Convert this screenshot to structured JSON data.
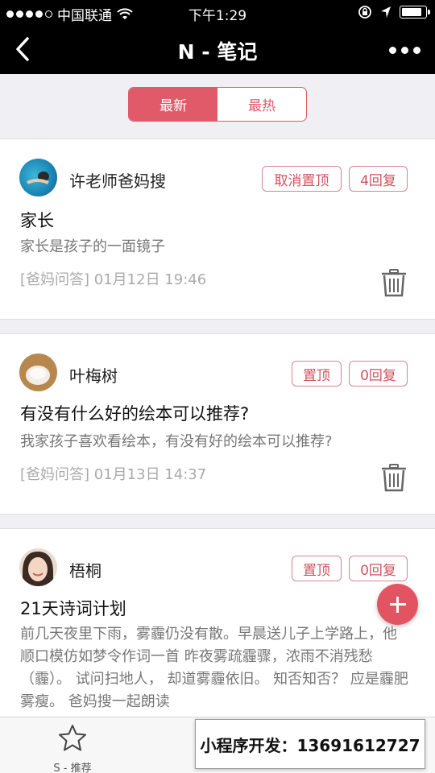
{
  "status": {
    "carrier": "中国联通",
    "time": "下午1:29",
    "battery_level": 0.9
  },
  "navbar": {
    "title": "N - 笔记"
  },
  "segment": {
    "tabs": [
      {
        "label": "最新",
        "active": true
      },
      {
        "label": "最热",
        "active": false
      }
    ]
  },
  "posts": [
    {
      "author": "许老师爸妈搜",
      "pin_label": "取消置顶",
      "reply_label": "4回复",
      "title": "家长",
      "body": "家长是孩子的一面镜子",
      "meta": "[爸妈问答] 01月12日 19:46"
    },
    {
      "author": "叶梅树",
      "pin_label": "置顶",
      "reply_label": "0回复",
      "title": "有没有什么好的绘本可以推荐?",
      "body": "我家孩子喜欢看绘本，有没有好的绘本可以推荐?",
      "meta": "[爸妈问答] 01月13日 14:37"
    },
    {
      "author": "梧桐",
      "pin_label": "置顶",
      "reply_label": "0回复",
      "title": "21天诗词计划",
      "body": "前几天夜里下雨，雾霾仍没有散。早晨送儿子上学路上，他顺口模仿如梦令作词一首 昨夜雾疏霾骤，浓雨不消残愁（霾）。 试问扫地人， 却道雾霾依旧。 知否知否？ 应是霾肥雾瘦。 爸妈搜一起朗读"
    }
  ],
  "tabbar": {
    "items": [
      {
        "label": "S - 推荐",
        "icon": "star-icon"
      }
    ]
  },
  "ad": {
    "text": "小程序开发：13691612727"
  },
  "colors": {
    "accent": "#e05a6a",
    "bar": "#000000"
  }
}
